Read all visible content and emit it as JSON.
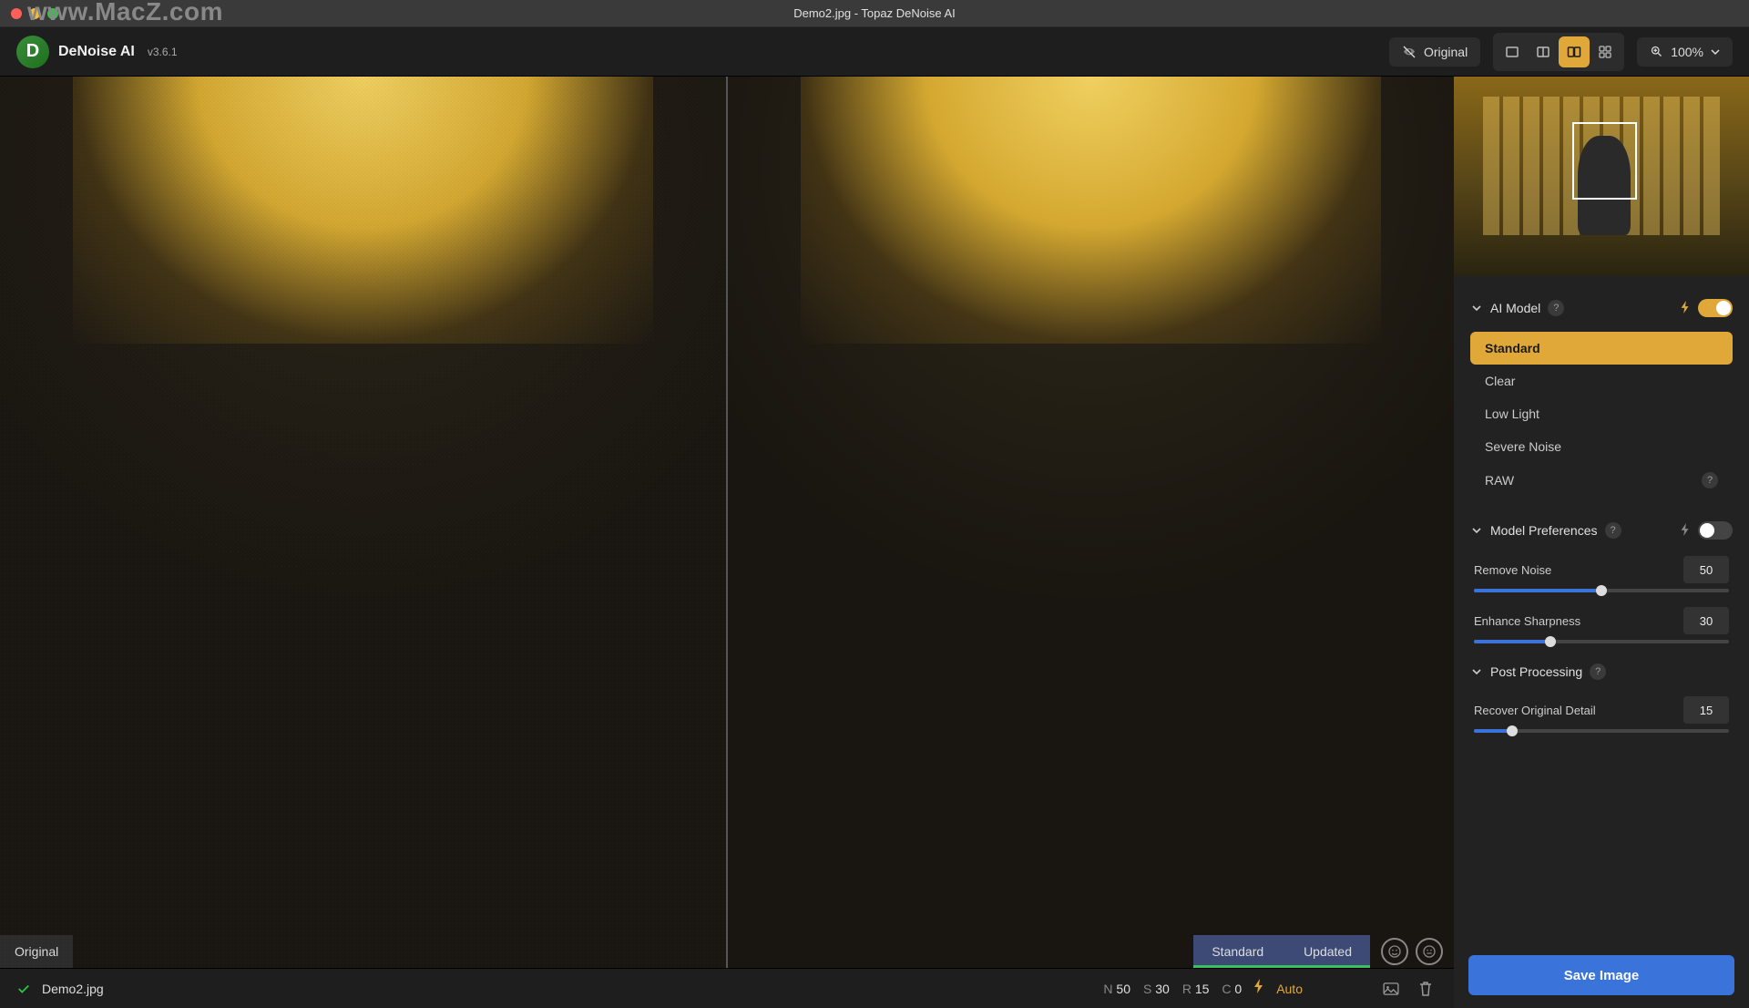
{
  "watermark": "www.MacZ.com",
  "title": "Demo2.jpg - Topaz DeNoise AI",
  "app": {
    "name": "DeNoise AI",
    "version": "v3.6.1"
  },
  "toolbar": {
    "original": "Original",
    "zoom": "100%"
  },
  "canvas": {
    "original_label": "Original",
    "model_label": "Standard",
    "updated_label": "Updated"
  },
  "bottom": {
    "filename": "Demo2.jpg",
    "params": {
      "N": "50",
      "S": "30",
      "R": "15",
      "C": "0"
    },
    "auto": "Auto"
  },
  "panel": {
    "ai_model": {
      "title": "AI Model",
      "items": [
        "Standard",
        "Clear",
        "Low Light",
        "Severe Noise",
        "RAW"
      ],
      "selected": 0
    },
    "model_prefs": {
      "title": "Model Preferences",
      "remove_noise": {
        "label": "Remove Noise",
        "value": "50",
        "pct": 50
      },
      "enhance_sharpness": {
        "label": "Enhance Sharpness",
        "value": "30",
        "pct": 30
      }
    },
    "post": {
      "title": "Post Processing",
      "recover_detail": {
        "label": "Recover Original Detail",
        "value": "15",
        "pct": 15
      }
    },
    "save": "Save Image"
  }
}
